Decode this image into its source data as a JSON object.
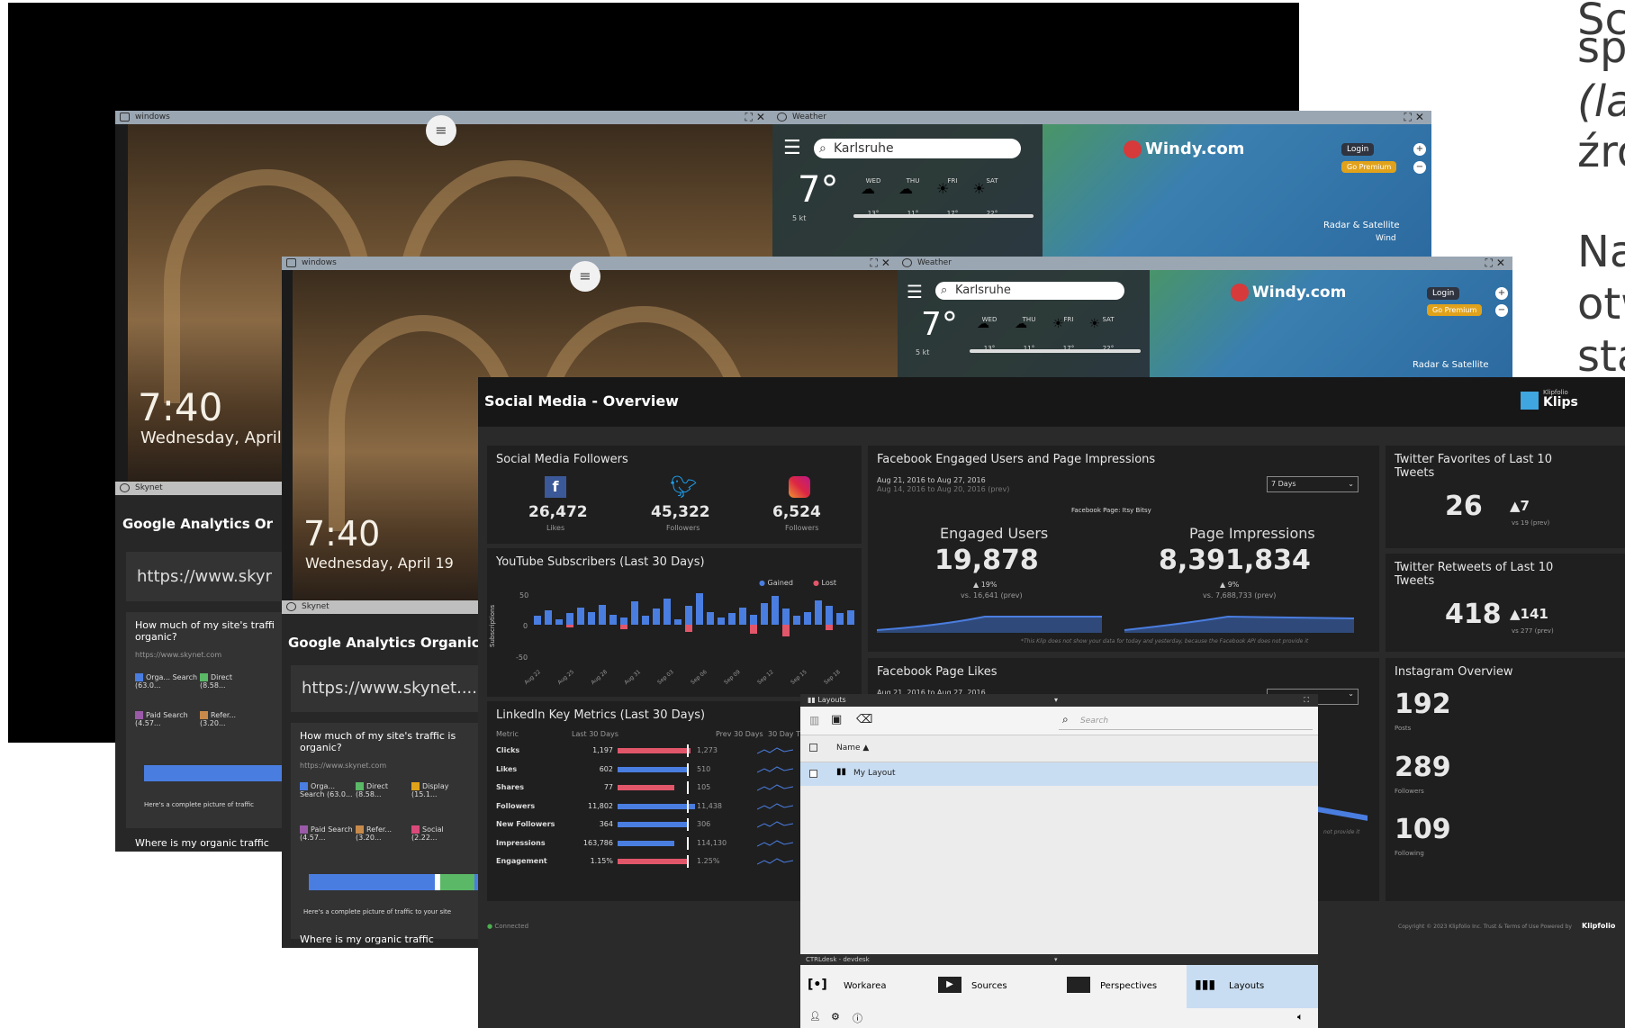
{
  "right_text": {
    "l1": "Sc",
    "l2": "sp",
    "l3": "(la",
    "l4": "źró",
    "l5": "Na",
    "l6": "otw",
    "l7": "sta"
  },
  "windows": {
    "back_lock": {
      "title": "windows",
      "time": "7:40",
      "date": "Wednesday, April 1"
    },
    "back_weather": {
      "title": "Weather",
      "search": "Karlsruhe",
      "temp": "7°",
      "wind": "5 kt",
      "brand": "Windy.com",
      "login": "Login",
      "premium": "Go Premium",
      "radar": "Radar & Satellite",
      "wind_label": "Wind",
      "days": [
        "WED",
        "THU",
        "FRI",
        "SAT"
      ],
      "temps": [
        "13°",
        "11°",
        "17°",
        "22°"
      ]
    },
    "back_ga": {
      "bar_title": "Skynet",
      "title": "Google Analytics Or",
      "url": "https://www.skyr",
      "question": "How much of my site's traffi organic?",
      "site": "https://www.skynet.com",
      "l1": "Orga... Search (63.0...",
      "l2": "Direct (8.58...",
      "l3": "Paid Search (4.57...",
      "l4": "Refer... (3.20...",
      "foot": "Here's a complete picture of traffic",
      "next": "Where is my organic traffic"
    },
    "front_lock": {
      "title": "windows",
      "time": "7:40",
      "date": "Wednesday, April 19"
    },
    "front_weather": {
      "title": "Weather",
      "search": "Karlsruhe",
      "temp": "7°",
      "wind": "5 kt",
      "brand": "Windy.com",
      "login": "Login",
      "premium": "Go Premium",
      "radar": "Radar & Satellite",
      "days": [
        "WED",
        "THU",
        "FRI",
        "SAT"
      ],
      "temps": [
        "13°",
        "11°",
        "17°",
        "22°"
      ]
    },
    "front_ga": {
      "bar_title": "Skynet",
      "title": "Google Analytics Organic",
      "url": "https://www.skynet....",
      "question": "How much of my site's traffic is organic?",
      "site": "https://www.skynet.com",
      "l1": "Orga... Search (63.0...",
      "l2": "Direct (8.58...",
      "l3": "Display (15.1...",
      "l4": "Paid Search (4.57...",
      "l5": "Refer... (3.20...",
      "l6": "Social (2.22...",
      "foot": "Here's a complete picture of traffic to your site",
      "next": "Where is my organic traffic"
    }
  },
  "dashboard": {
    "title": "Social Media - Overview",
    "brand_small": "Klipfolio",
    "brand": "Klips",
    "followers": {
      "title": "Social Media Followers",
      "fb": "26,472",
      "fb_l": "Likes",
      "tw": "45,322",
      "tw_l": "Followers",
      "ig": "6,524",
      "ig_l": "Followers"
    },
    "youtube": {
      "title": "YouTube Subscribers (Last 30 Days)",
      "gained": "Gained",
      "lost": "Lost",
      "ylabel": "Subscriptions",
      "y50": "50",
      "y0": "0",
      "yn50": "-50",
      "dates": [
        "Aug 22",
        "Aug 25",
        "Aug 28",
        "Aug 31",
        "Sep 03",
        "Sep 06",
        "Sep 09",
        "Sep 12",
        "Sep 15",
        "Sep 18"
      ]
    },
    "linkedin": {
      "title": "LinkedIn Key Metrics (Last 30 Days)",
      "h1": "Metric",
      "h2": "Last 30 Days",
      "h3": "Prev 30 Days",
      "h4": "30 Day T",
      "rows": [
        {
          "m": "Clicks",
          "v": "1,197",
          "p": "1,273",
          "c": "r",
          "f": 0.9
        },
        {
          "m": "Likes",
          "v": "602",
          "p": "510",
          "c": "b",
          "f": 0.85
        },
        {
          "m": "Shares",
          "v": "77",
          "p": "105",
          "c": "r",
          "f": 0.7
        },
        {
          "m": "Followers",
          "v": "11,802",
          "p": "11,438",
          "c": "b",
          "f": 0.95
        },
        {
          "m": "New Followers",
          "v": "364",
          "p": "306",
          "c": "b",
          "f": 0.88
        },
        {
          "m": "Impressions",
          "v": "163,786",
          "p": "114,130",
          "c": "b",
          "f": 0.7
        },
        {
          "m": "Engagement",
          "v": "1.15%",
          "p": "1.25%",
          "c": "r",
          "f": 0.88
        }
      ]
    },
    "fb_engaged": {
      "title": "Facebook Engaged Users and Page Impressions",
      "range": "Aug 21, 2016 to Aug 27, 2016",
      "prev": "Aug 14, 2016 to Aug 20, 2016 (prev)",
      "select": "7 Days",
      "page": "Facebook Page: Itsy Bitsy",
      "eu_l": "Engaged Users",
      "eu": "19,878",
      "eu_ch": "19%",
      "eu_prev": "vs. 16,641 (prev)",
      "pi_l": "Page Impressions",
      "pi": "8,391,834",
      "pi_ch": "9%",
      "pi_prev": "vs. 7,688,733 (prev)",
      "note": "*This Klip does not show your data for today and yesterday, because the Facebook API does not provide it"
    },
    "fb_likes": {
      "title": "Facebook Page Likes",
      "range": "Aug 21, 2016 to Aug 27, 2016",
      "note": "not provide it"
    },
    "tw_fav": {
      "title": "Twitter Favorites of Last 10 Tweets",
      "val": "26",
      "ch": "7",
      "prev": "vs 19 (prev)"
    },
    "tw_rt": {
      "title": "Twitter Retweets of Last 10 Tweets",
      "val": "418",
      "ch": "141",
      "prev": "vs 277 (prev)"
    },
    "ig": {
      "title": "Instagram Overview",
      "posts": "192",
      "posts_l": "Posts",
      "fol": "289",
      "fol_l": "Followers",
      "fing": "109",
      "fing_l": "Following"
    },
    "connected": "Connected",
    "copyright": "Copyright © 2023 Klipfolio Inc.   Trust & Terms of Use   Powered by",
    "powered": "Klipfolio"
  },
  "dialog": {
    "title": "Layouts",
    "search": "Search",
    "col": "Name ▲",
    "row": "My Layout",
    "bottom_title": "CTRLdesk - devdesk",
    "tabs": {
      "workarea": "Workarea",
      "sources": "Sources",
      "perspectives": "Perspectives",
      "layouts": "Layouts"
    }
  },
  "colors": {
    "accent": "#4a7de0",
    "neg": "#e2566a",
    "dialog_sel": "#c9ddf2"
  }
}
